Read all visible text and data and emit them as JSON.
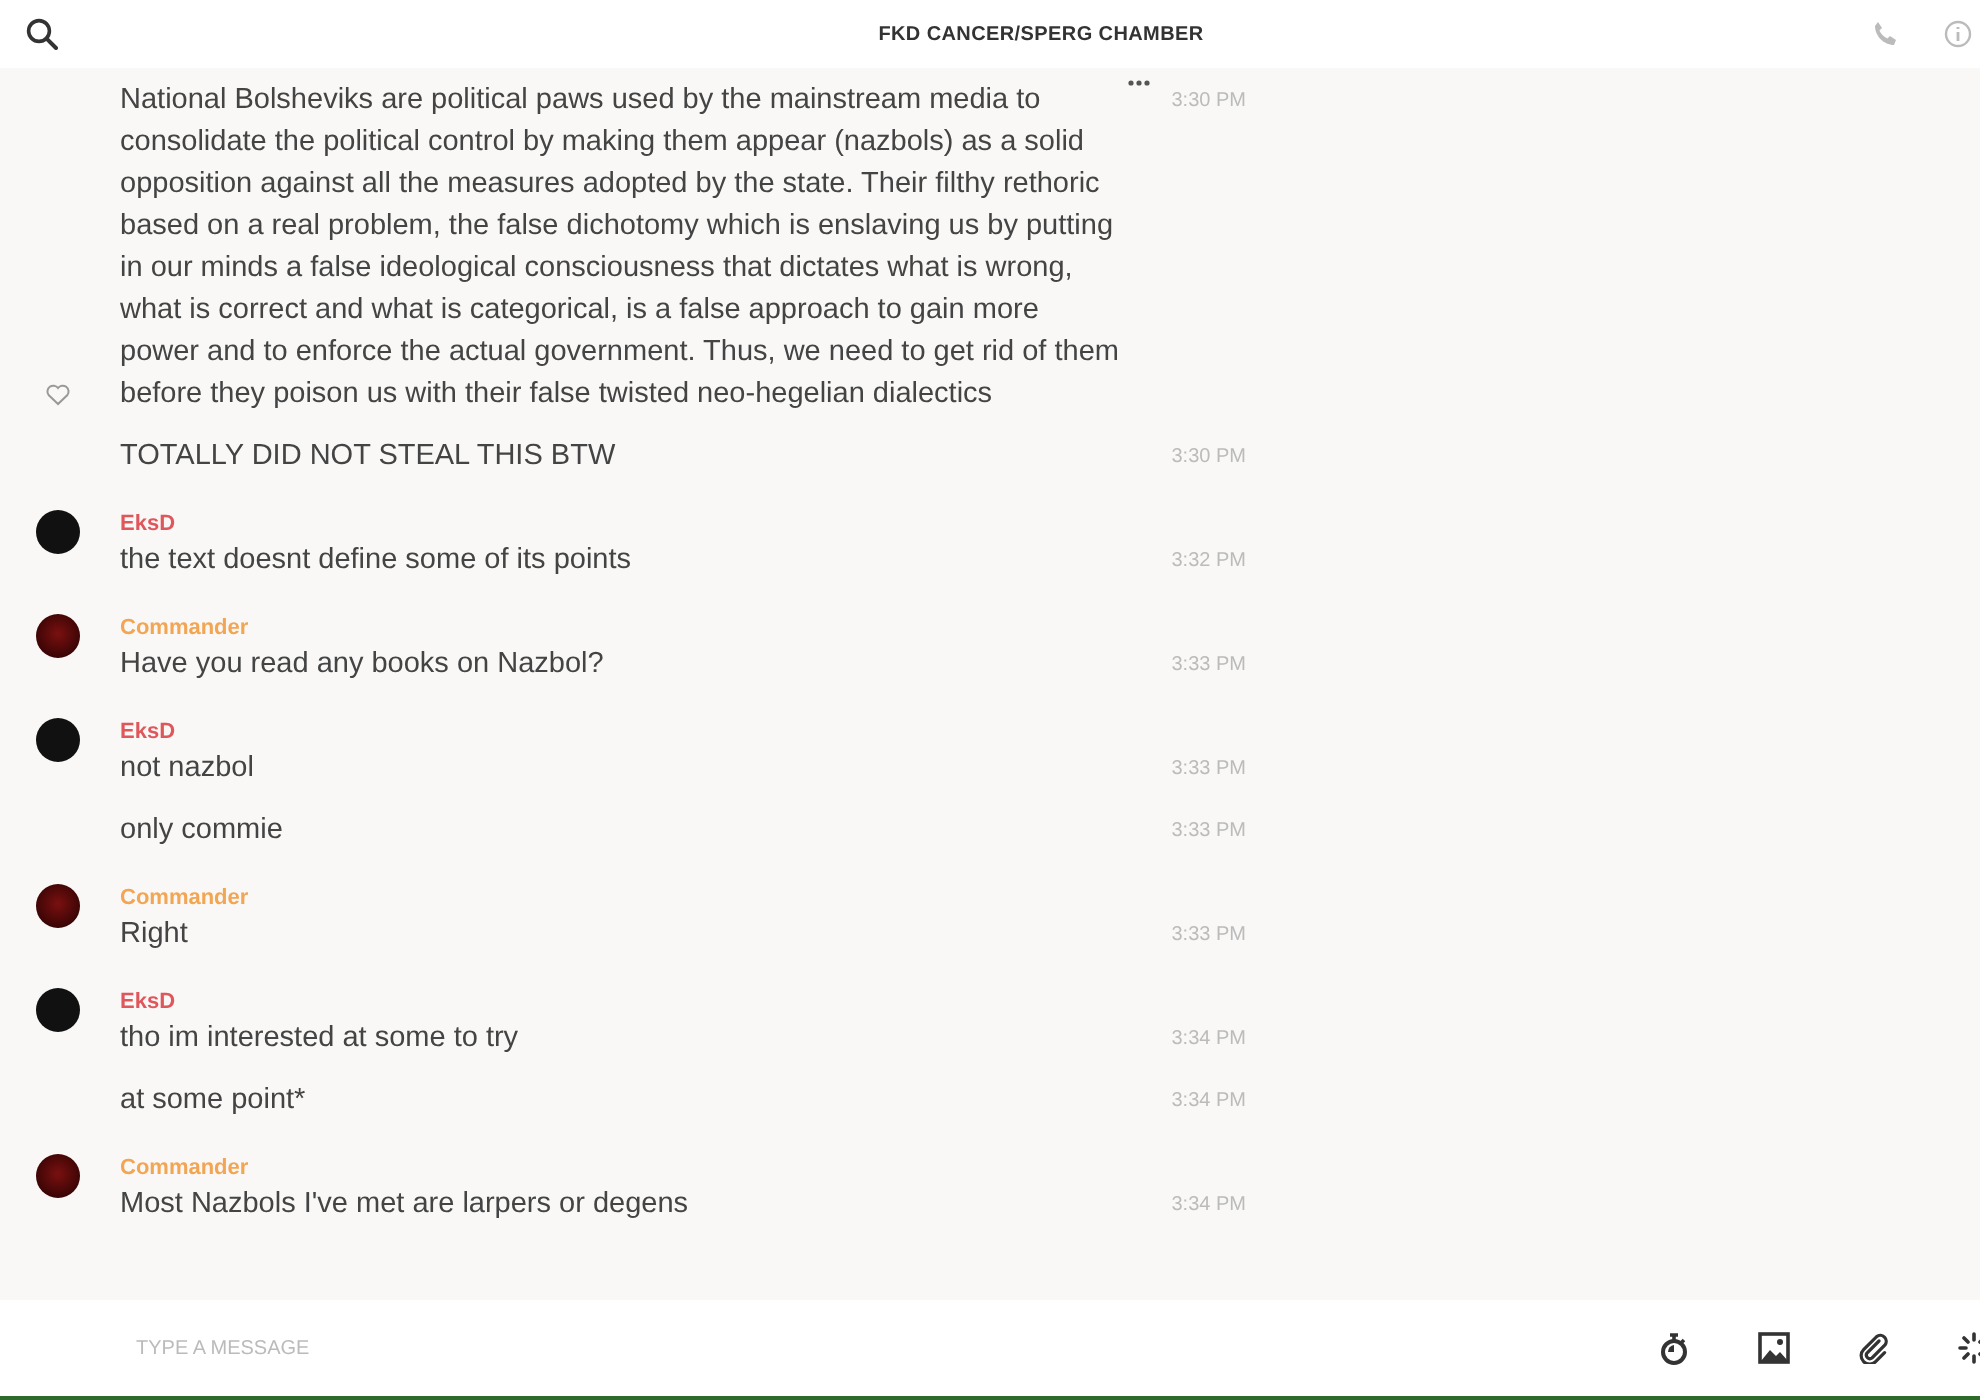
{
  "header": {
    "title": "FKD CANCER/SPERG CHAMBER"
  },
  "groups": [
    {
      "messages": [
        {
          "text": "National Bolsheviks are political paws used by the mainstream media to consolidate the political control by making them appear (nazbols) as a solid opposition against all the measures adopted by the state. Their filthy rethoric based on a real problem, the false dichotomy which is enslaving us by putting in our minds a false ideological consciousness that dictates what is wrong, what is correct and what is categorical, is a false approach to gain more power and to enforce the actual government. Thus, we need to get rid of them before they poison us with their false twisted neo-hegelian dialectics",
          "time": "3:30 PM",
          "hovered": true
        },
        {
          "text": "TOTALLY DID NOT STEAL THIS BTW",
          "time": "3:30 PM",
          "hovered": false
        }
      ]
    },
    {
      "author": "EksD",
      "color": "#e0575b",
      "messages": [
        {
          "text": "the text doesnt define some of its points",
          "time": "3:32 PM",
          "hovered": false
        }
      ]
    },
    {
      "author": "Commander",
      "color": "#f2a553",
      "messages": [
        {
          "text": "Have you read any books on Nazbol?",
          "time": "3:33 PM",
          "hovered": false
        }
      ]
    },
    {
      "author": "EksD",
      "color": "#e0575b",
      "messages": [
        {
          "text": "not nazbol",
          "time": "3:33 PM",
          "hovered": false
        },
        {
          "text": "only commie",
          "time": "3:33 PM",
          "hovered": false
        }
      ]
    },
    {
      "author": "Commander",
      "color": "#f2a553",
      "messages": [
        {
          "text": "Right",
          "time": "3:33 PM",
          "hovered": false
        }
      ]
    },
    {
      "author": "EksD",
      "color": "#e0575b",
      "messages": [
        {
          "text": "tho im interested at some to try",
          "time": "3:34 PM",
          "hovered": false
        },
        {
          "text": "at some point*",
          "time": "3:34 PM",
          "hovered": false
        }
      ]
    },
    {
      "author": "Commander",
      "color": "#f2a553",
      "messages": [
        {
          "text": "Most Nazbols I've met are larpers or degens",
          "time": "3:34 PM",
          "hovered": false
        }
      ]
    }
  ],
  "composer": {
    "placeholder": "TYPE A MESSAGE"
  }
}
